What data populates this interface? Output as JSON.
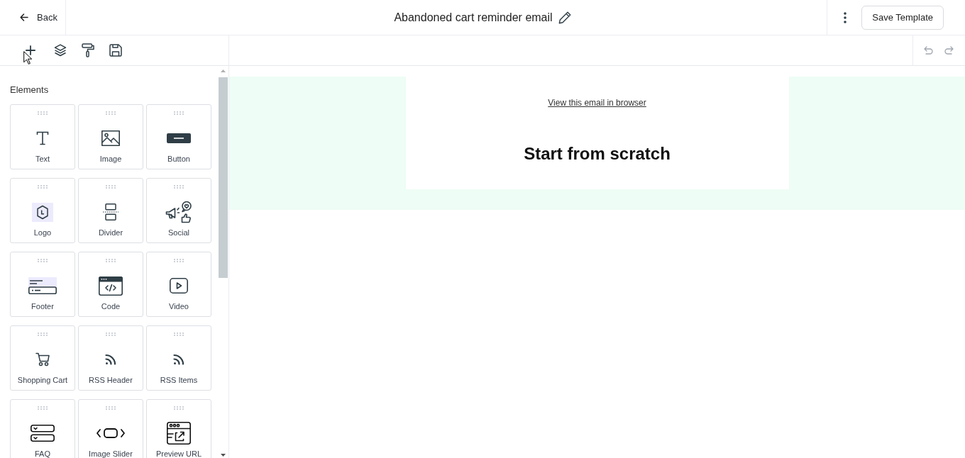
{
  "header": {
    "back": "Back",
    "title": "Abandoned cart reminder email",
    "save_button": "Save Template"
  },
  "panel": {
    "heading": "Elements",
    "elements": [
      {
        "kind": "text",
        "label": "Text"
      },
      {
        "kind": "image",
        "label": "Image"
      },
      {
        "kind": "button",
        "label": "Button"
      },
      {
        "kind": "logo",
        "label": "Logo"
      },
      {
        "kind": "divider",
        "label": "Divider"
      },
      {
        "kind": "social",
        "label": "Social"
      },
      {
        "kind": "footer",
        "label": "Footer"
      },
      {
        "kind": "code",
        "label": "Code"
      },
      {
        "kind": "video",
        "label": "Video"
      },
      {
        "kind": "cart",
        "label": "Shopping Cart"
      },
      {
        "kind": "rss",
        "label": "RSS Header"
      },
      {
        "kind": "rss",
        "label": "RSS Items"
      },
      {
        "kind": "faq",
        "label": "FAQ"
      },
      {
        "kind": "slider",
        "label": "Image Slider"
      },
      {
        "kind": "preview",
        "label": "Preview URL"
      }
    ]
  },
  "canvas": {
    "link": "View this email in browser",
    "heading": "Start from scratch"
  }
}
